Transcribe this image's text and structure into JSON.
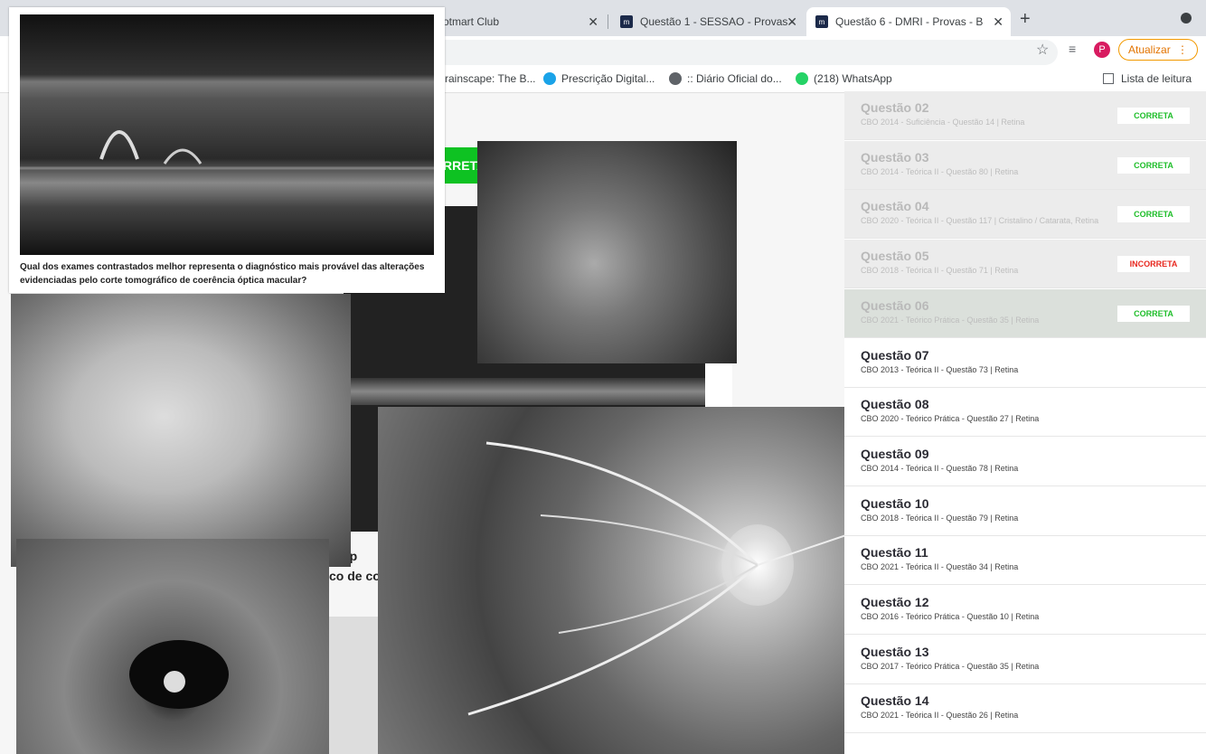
{
  "browser": {
    "tabs": [
      {
        "label": "otmart Club"
      },
      {
        "label": "Questão 1 - SESSAO - Provas -"
      },
      {
        "label": "Questão 6 - DMRI - Provas - B"
      }
    ],
    "new_tab": "+",
    "avatar_letter": "P",
    "update_label": "Atualizar",
    "update_menu": "⋮",
    "bookmarks": [
      {
        "label": "rainscape: The B..."
      },
      {
        "label": "Prescrição Digital..."
      },
      {
        "label": ":: Diário Oficial do..."
      },
      {
        "label": "(218) WhatsApp"
      }
    ],
    "reading_list": "Lista de leitura"
  },
  "page": {
    "answer_button": "RRETA",
    "background_question_line1": "r rep",
    "background_question_line2": "co de co",
    "oct_caption": "Qual dos exames contrastados melhor representa o diagnóstico mais provável das alterações evidenciadas pelo corte tomográfico de coerência óptica macular?"
  },
  "sidebar": {
    "questions": [
      {
        "title": "Questão 02",
        "meta": "CBO 2014 - Suficiência - Questão 14 | Retina",
        "status": "CORRETA",
        "state": "done"
      },
      {
        "title": "Questão 03",
        "meta": "CBO 2014 - Teórica II - Questão 80 | Retina",
        "status": "CORRETA",
        "state": "done"
      },
      {
        "title": "Questão 04",
        "meta": "CBO 2020 - Teórica II - Questão 117 | Cristalino / Catarata, Retina",
        "status": "CORRETA",
        "state": "done"
      },
      {
        "title": "Questão 05",
        "meta": "CBO 2018 - Teórica II - Questão 71 | Retina",
        "status": "INCORRETA",
        "state": "done"
      },
      {
        "title": "Questão 06",
        "meta": "CBO 2021 - Teórico Prática - Questão 35 | Retina",
        "status": "CORRETA",
        "state": "current"
      },
      {
        "title": "Questão 07",
        "meta": "CBO 2013 - Teórica II - Questão 73 | Retina",
        "status": "",
        "state": "todo"
      },
      {
        "title": "Questão 08",
        "meta": "CBO 2020 - Teórico Prática - Questão 27 | Retina",
        "status": "",
        "state": "todo"
      },
      {
        "title": "Questão 09",
        "meta": "CBO 2014 - Teórica II - Questão 78 | Retina",
        "status": "",
        "state": "todo"
      },
      {
        "title": "Questão 10",
        "meta": "CBO 2018 - Teórica II - Questão 79 | Retina",
        "status": "",
        "state": "todo"
      },
      {
        "title": "Questão 11",
        "meta": "CBO 2021 - Teórica II - Questão 34 | Retina",
        "status": "",
        "state": "todo"
      },
      {
        "title": "Questão 12",
        "meta": "CBO 2016 - Teórico Prática - Questão 10 | Retina",
        "status": "",
        "state": "todo"
      },
      {
        "title": "Questão 13",
        "meta": "CBO 2017 - Teórico Prática - Questão 35 | Retina",
        "status": "",
        "state": "todo"
      },
      {
        "title": "Questão 14",
        "meta": "CBO 2021 - Teórica II - Questão 26 | Retina",
        "status": "",
        "state": "todo"
      }
    ]
  },
  "colors": {
    "correct": "#1fbe2a",
    "incorrect": "#e8281f",
    "answer_button": "#0ec222"
  }
}
